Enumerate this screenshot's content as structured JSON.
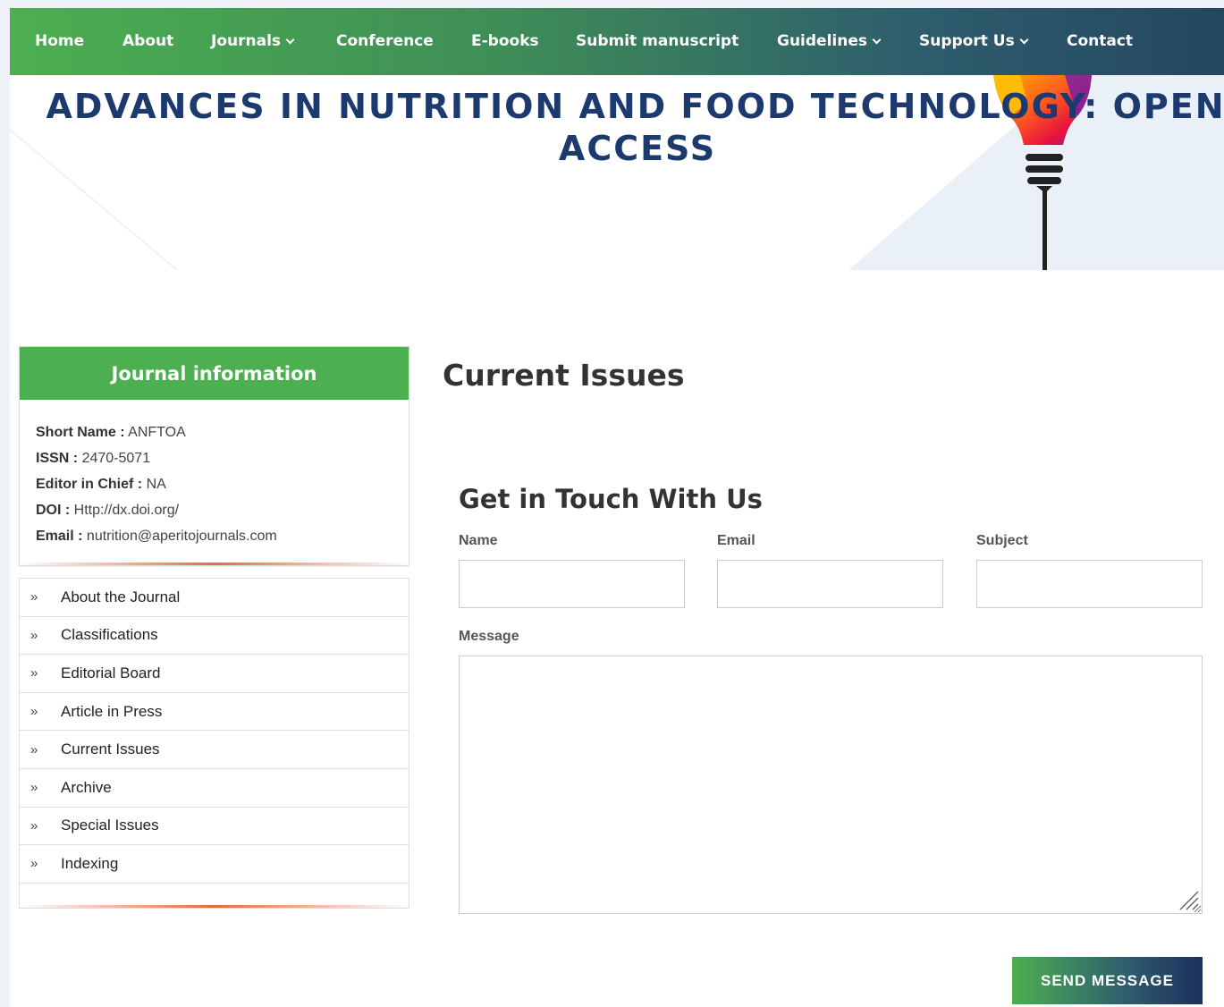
{
  "nav": {
    "items": [
      {
        "label": "Home",
        "dropdown": false
      },
      {
        "label": "About",
        "dropdown": false
      },
      {
        "label": "Journals",
        "dropdown": true
      },
      {
        "label": "Conference",
        "dropdown": false
      },
      {
        "label": "E-books",
        "dropdown": false
      },
      {
        "label": "Submit manuscript",
        "dropdown": false
      },
      {
        "label": "Guidelines",
        "dropdown": true
      },
      {
        "label": "Support Us",
        "dropdown": true
      },
      {
        "label": "Contact",
        "dropdown": false
      }
    ]
  },
  "banner": {
    "title_line1": "ADVANCES IN NUTRITION AND FOOD TECHNOLOGY: OPEN",
    "title_line2": "ACCESS",
    "icon": "lightbulb-icon"
  },
  "journal_info": {
    "heading": "Journal information",
    "rows": [
      {
        "label": "Short Name :",
        "value": "ANFTOA"
      },
      {
        "label": "ISSN :",
        "value": "2470-5071"
      },
      {
        "label": "Editor in Chief :",
        "value": "NA"
      },
      {
        "label": "DOI :",
        "value": "Http://dx.doi.org/"
      },
      {
        "label": "Email :",
        "value": "nutrition@aperitojournals.com"
      }
    ]
  },
  "sidebar_menu": {
    "arrow_glyph": "»",
    "items": [
      "About the Journal",
      "Classifications",
      "Editorial Board",
      "Article in Press",
      "Current Issues",
      "Archive",
      "Special Issues",
      "Indexing"
    ]
  },
  "main": {
    "section_title": "Current Issues"
  },
  "contact_form": {
    "title": "Get in Touch With Us",
    "name_label": "Name",
    "email_label": "Email",
    "subject_label": "Subject",
    "message_label": "Message",
    "name_value": "",
    "email_value": "",
    "subject_value": "",
    "message_value": "",
    "submit_label": "SEND MESSAGE"
  },
  "colors": {
    "nav_gradient_start": "#4caf50",
    "nav_gradient_end": "#24475f",
    "title_blue": "#1d3a6e",
    "sidebar_header_green": "#4caf50",
    "accent_orange": "#e86a3f"
  }
}
